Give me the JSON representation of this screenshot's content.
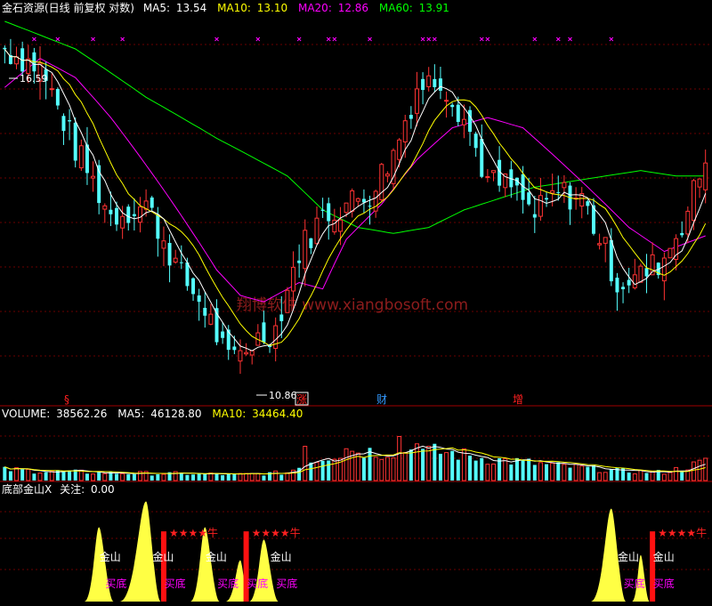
{
  "chart_data": [
    {
      "type": "candlestick",
      "panel": "price",
      "legend": {
        "title": "金石资源(日线 前复权 对数)",
        "items": [
          {
            "label": "MA5:",
            "value": "13.54",
            "color": "#ffffff"
          },
          {
            "label": "MA10:",
            "value": "13.10",
            "color": "#ffff00"
          },
          {
            "label": "MA20:",
            "value": "12.86",
            "color": "#ff00ff"
          },
          {
            "label": "MA60:",
            "value": "13.91",
            "color": "#00ff00"
          }
        ]
      },
      "annotations": {
        "high_label": "16.59",
        "low_label": "10.86"
      },
      "event_markers": [
        {
          "label": "§",
          "color": "#ff2020"
        },
        {
          "label": "涨",
          "color": "#ff2020",
          "boxed": true
        },
        {
          "label": "财",
          "color": "#3399ff"
        },
        {
          "label": "增",
          "color": "#ff2020"
        }
      ],
      "watermark": "翔博软件 www.xiangbosoft.com",
      "colors": {
        "up": "#ff3333",
        "down": "#54ffff",
        "ma5": "#ffffff",
        "ma10": "#ffff00",
        "ma20": "#ff00ff",
        "ma60": "#00ff00",
        "cross": "#ff00ff"
      },
      "candle_count": 120,
      "ylim": [
        10.5,
        17.0
      ],
      "scale": "log",
      "close_path": [
        [
          0,
          16.4
        ],
        [
          6,
          16.0
        ],
        [
          12,
          14.4
        ],
        [
          18,
          13.2
        ],
        [
          24,
          13.4
        ],
        [
          30,
          12.2
        ],
        [
          34,
          11.7
        ],
        [
          38,
          10.9
        ],
        [
          42,
          11.2
        ],
        [
          46,
          11.4
        ],
        [
          50,
          12.6
        ],
        [
          54,
          13.2
        ],
        [
          58,
          13.4
        ],
        [
          62,
          13.6
        ],
        [
          66,
          14.3
        ],
        [
          70,
          15.6
        ],
        [
          74,
          15.8
        ],
        [
          78,
          15.0
        ],
        [
          82,
          13.8
        ],
        [
          86,
          13.7
        ],
        [
          90,
          13.2
        ],
        [
          94,
          13.6
        ],
        [
          98,
          13.5
        ],
        [
          102,
          12.6
        ],
        [
          104,
          12.1
        ],
        [
          108,
          12.2
        ],
        [
          112,
          12.5
        ],
        [
          116,
          13.3
        ],
        [
          119,
          14.2
        ]
      ],
      "ma60_path": [
        [
          0,
          17.0
        ],
        [
          12,
          16.4
        ],
        [
          24,
          15.4
        ],
        [
          36,
          14.6
        ],
        [
          48,
          13.9
        ],
        [
          54,
          13.3
        ],
        [
          60,
          13.0
        ],
        [
          66,
          12.9
        ],
        [
          72,
          13.0
        ],
        [
          78,
          13.3
        ],
        [
          84,
          13.5
        ],
        [
          90,
          13.7
        ],
        [
          96,
          13.8
        ],
        [
          102,
          13.9
        ],
        [
          108,
          14.0
        ],
        [
          114,
          13.9
        ],
        [
          119,
          13.9
        ]
      ],
      "ma20_path": [
        [
          0,
          15.6
        ],
        [
          6,
          16.2
        ],
        [
          12,
          15.8
        ],
        [
          18,
          15.0
        ],
        [
          24,
          14.1
        ],
        [
          30,
          13.2
        ],
        [
          36,
          12.3
        ],
        [
          40,
          11.9
        ],
        [
          44,
          11.8
        ],
        [
          50,
          12.1
        ],
        [
          54,
          12.0
        ],
        [
          58,
          12.8
        ],
        [
          64,
          13.4
        ],
        [
          70,
          14.2
        ],
        [
          76,
          14.8
        ],
        [
          82,
          15.0
        ],
        [
          88,
          14.8
        ],
        [
          94,
          14.2
        ],
        [
          100,
          13.6
        ],
        [
          106,
          13.0
        ],
        [
          112,
          12.6
        ],
        [
          119,
          12.86
        ]
      ],
      "cross_marks": [
        5,
        9,
        15,
        20,
        36,
        43,
        50,
        55,
        56,
        62,
        71,
        72,
        73,
        81,
        82,
        90,
        94,
        96,
        103
      ]
    },
    {
      "type": "bar",
      "panel": "volume",
      "legend": {
        "items": [
          {
            "label": "VOLUME:",
            "value": "38562.26",
            "color": "#ffffff"
          },
          {
            "label": "MA5:",
            "value": "46128.80",
            "color": "#ffffff"
          },
          {
            "label": "MA10:",
            "value": "34464.40",
            "color": "#ffff00"
          }
        ]
      },
      "ylim": [
        0,
        120000
      ],
      "level_path": [
        [
          0,
          22000
        ],
        [
          10,
          18000
        ],
        [
          20,
          15000
        ],
        [
          30,
          14000
        ],
        [
          40,
          12000
        ],
        [
          48,
          16000
        ],
        [
          52,
          40000
        ],
        [
          56,
          55000
        ],
        [
          60,
          62000
        ],
        [
          64,
          58000
        ],
        [
          68,
          64000
        ],
        [
          72,
          60000
        ],
        [
          76,
          56000
        ],
        [
          80,
          48000
        ],
        [
          84,
          42000
        ],
        [
          88,
          38000
        ],
        [
          92,
          32000
        ],
        [
          96,
          28000
        ],
        [
          100,
          24000
        ],
        [
          104,
          20000
        ],
        [
          108,
          18000
        ],
        [
          112,
          17000
        ],
        [
          116,
          28000
        ],
        [
          119,
          38562
        ]
      ],
      "big_bars": [
        [
          67,
          90000
        ],
        [
          70,
          75000
        ],
        [
          72,
          70000
        ],
        [
          51,
          70000
        ],
        [
          58,
          65000
        ]
      ]
    },
    {
      "type": "indicator",
      "panel": "indicator",
      "legend": {
        "title": "底部金山X",
        "items": [
          {
            "label": "关注:",
            "value": "0.00",
            "color": "#ffffff"
          }
        ]
      },
      "ylim": [
        0,
        100
      ],
      "mountains": [
        {
          "start": 14,
          "peak": 16,
          "end": 18,
          "height": 72
        },
        {
          "start": 20,
          "peak": 24,
          "end": 26,
          "height": 97
        },
        {
          "start": 32,
          "peak": 34,
          "end": 36,
          "height": 72
        },
        {
          "start": 38,
          "peak": 40,
          "end": 41,
          "height": 40
        },
        {
          "start": 42,
          "peak": 44,
          "end": 46,
          "height": 60
        },
        {
          "start": 100,
          "peak": 103,
          "end": 105,
          "height": 90
        },
        {
          "start": 107,
          "peak": 108,
          "end": 109,
          "height": 45
        }
      ],
      "signals": [
        {
          "at": 27,
          "height": 68,
          "stars": "★★★★牛"
        },
        {
          "at": 41,
          "height": 68,
          "stars": "★★★★牛"
        },
        {
          "at": 110,
          "height": 68,
          "stars": "★★★★牛"
        }
      ],
      "labels": [
        {
          "at": 17,
          "text": "金山",
          "color": "#ffffff",
          "row": "upper"
        },
        {
          "at": 18,
          "text": "买底",
          "color": "#ff00ff",
          "row": "lower"
        },
        {
          "at": 26,
          "text": "金山",
          "color": "#ffffff",
          "row": "upper"
        },
        {
          "at": 28,
          "text": "买底",
          "color": "#ff00ff",
          "row": "lower"
        },
        {
          "at": 35,
          "text": "金山",
          "color": "#ffffff",
          "row": "upper"
        },
        {
          "at": 37,
          "text": "买底",
          "color": "#ff00ff",
          "row": "lower"
        },
        {
          "at": 42,
          "text": "买底",
          "color": "#ff00ff",
          "row": "lower"
        },
        {
          "at": 46,
          "text": "金山",
          "color": "#ffffff",
          "row": "upper"
        },
        {
          "at": 47,
          "text": "买底",
          "color": "#ff00ff",
          "row": "lower"
        },
        {
          "at": 105,
          "text": "金山",
          "color": "#ffffff",
          "row": "upper"
        },
        {
          "at": 106,
          "text": "买底",
          "color": "#ff00ff",
          "row": "lower"
        },
        {
          "at": 111,
          "text": "金山",
          "color": "#ffffff",
          "row": "upper"
        },
        {
          "at": 111,
          "text": "买底",
          "color": "#ff00ff",
          "row": "lower"
        }
      ]
    }
  ]
}
